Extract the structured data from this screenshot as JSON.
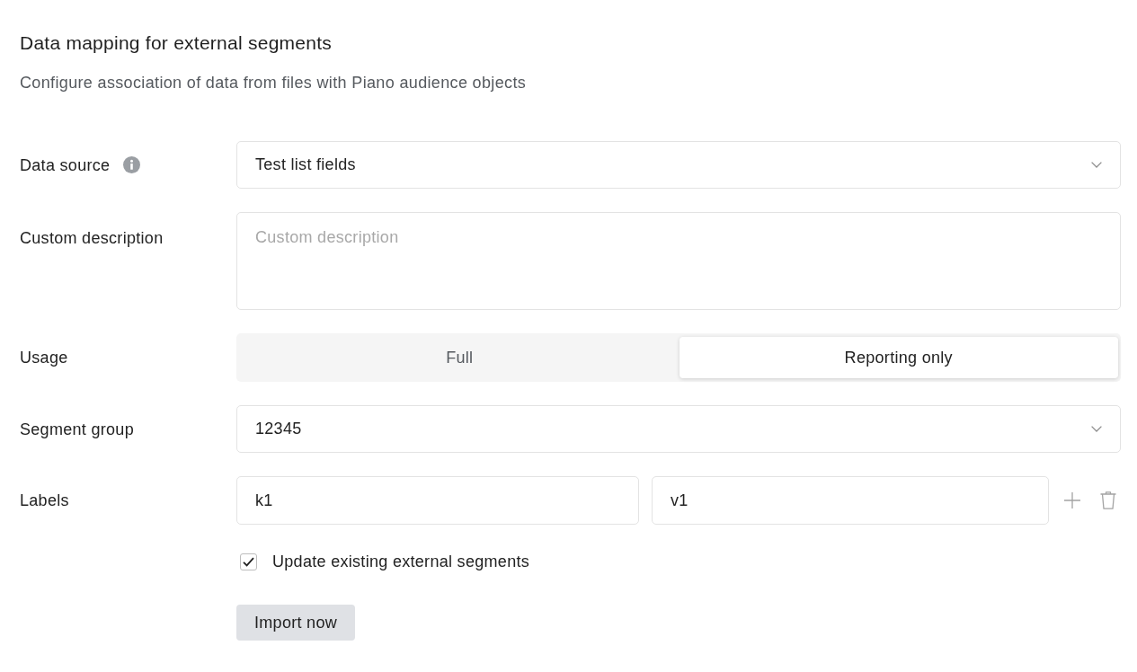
{
  "header": {
    "title": "Data mapping for external segments",
    "subtitle": "Configure association of data from files with Piano audience objects"
  },
  "fields": [
    {
      "kind": "select",
      "label": "Data source",
      "info": true,
      "value": "Test list fields"
    },
    {
      "kind": "textarea",
      "label": "Custom description",
      "info": false,
      "placeholder": "Custom description"
    },
    {
      "kind": "segmented",
      "label": "Usage",
      "info": false,
      "options": [
        {
          "label": "Full",
          "selected": false
        },
        {
          "label": "Reporting only",
          "selected": true
        }
      ]
    },
    {
      "kind": "select",
      "label": "Segment group",
      "info": false,
      "value": "12345"
    },
    {
      "kind": "pair",
      "label": "Labels",
      "info": false,
      "inputs": [
        {
          "value": "k1"
        },
        {
          "value": "v1"
        }
      ]
    }
  ],
  "checkbox": {
    "label": "Update existing external segments",
    "checked": true
  },
  "button": "Import now"
}
